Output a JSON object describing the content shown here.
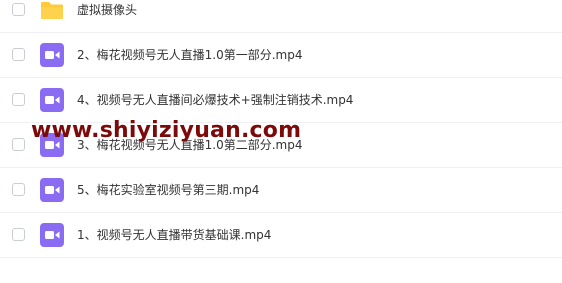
{
  "files": [
    {
      "name": "虚拟摄像头",
      "icon": "folder-icon"
    },
    {
      "name": "2、梅花视频号无人直播1.0第一部分.mp4",
      "icon": "video-file-icon"
    },
    {
      "name": "4、视频号无人直播间必爆技术+强制注销技术.mp4",
      "icon": "video-file-icon"
    },
    {
      "name": "3、梅花视频号无人直播1.0第二部分.mp4",
      "icon": "video-file-icon"
    },
    {
      "name": "5、梅花实验室视频号第三期.mp4",
      "icon": "video-file-icon"
    },
    {
      "name": "1、视频号无人直播带货基础课.mp4",
      "icon": "video-file-icon"
    }
  ],
  "watermark": "www.shiyiziyuan.com",
  "colors": {
    "folder": "#ffc93a",
    "video_icon": "#8a6cf2",
    "watermark": "#7d0a0a"
  }
}
